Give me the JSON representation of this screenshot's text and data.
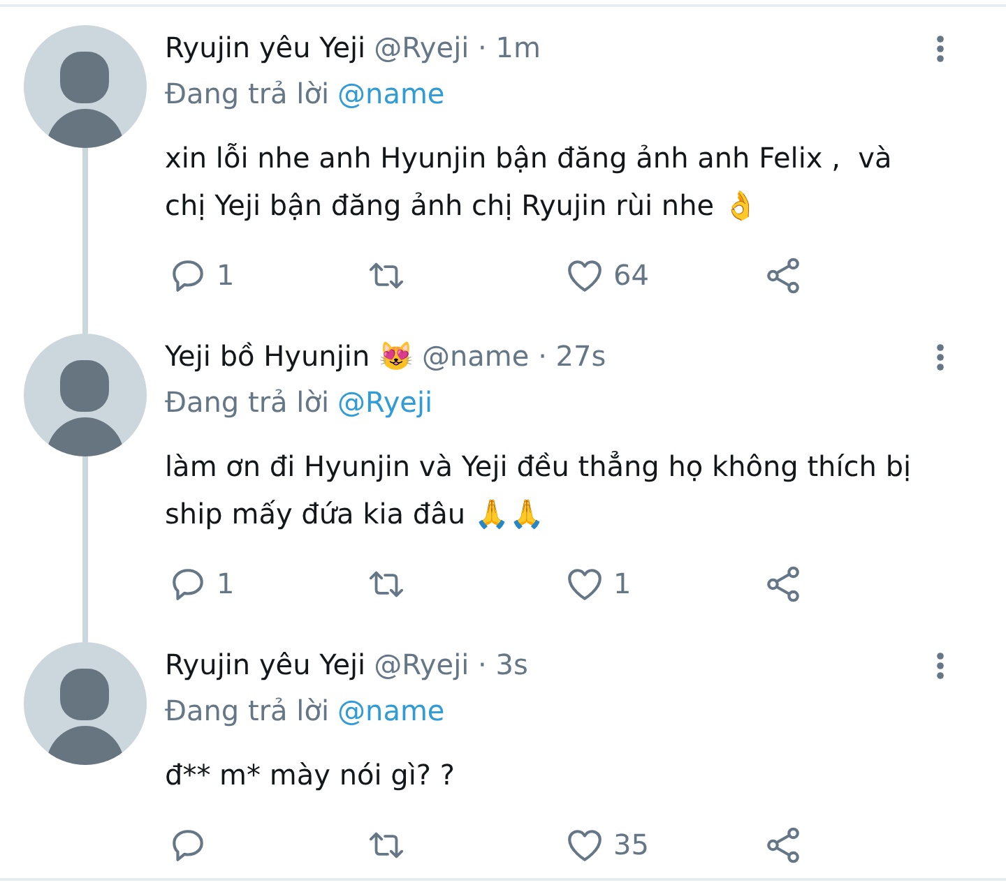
{
  "tweets": [
    {
      "author": "Ryujin yêu Yeji",
      "meta": "@Ryeji · 1m",
      "reply_label": "Đang trả lời",
      "reply_to": "@name",
      "text": "xin lỗi nhe anh Hyunjin bận đăng ảnh anh Felix ,  và chị Yeji bận đăng ảnh chị Ryujin rùi nhe 👌",
      "thread_below": true,
      "actions": [
        {
          "kind": "reply",
          "count": "1"
        },
        {
          "kind": "retweet"
        },
        {
          "kind": "like",
          "count": "64"
        },
        {
          "kind": "share"
        }
      ]
    },
    {
      "author": "Yeji bồ Hyunjin 😻",
      "meta": "@name · 27s",
      "reply_label": "Đang trả lời",
      "reply_to": "@Ryeji",
      "text": "làm ơn đi Hyunjin và Yeji đều thẳng họ không thích bị ship mấy đứa kia đâu 🙏🙏",
      "thread_below": true,
      "actions": [
        {
          "kind": "reply",
          "count": "1"
        },
        {
          "kind": "retweet"
        },
        {
          "kind": "like",
          "count": "1"
        },
        {
          "kind": "share"
        }
      ]
    },
    {
      "author": "Ryujin yêu Yeji",
      "meta": "@Ryeji · 3s",
      "reply_label": "Đang trả lời",
      "reply_to": "@name",
      "text": "đ** m* mày nói gì? ?",
      "thread_below": false,
      "actions": [
        {
          "kind": "reply"
        },
        {
          "kind": "retweet"
        },
        {
          "kind": "like",
          "count": "35"
        },
        {
          "kind": "share"
        }
      ]
    }
  ]
}
